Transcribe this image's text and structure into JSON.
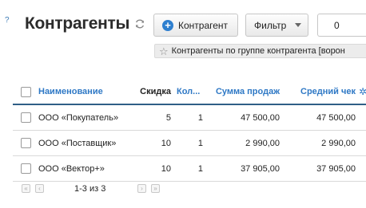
{
  "header": {
    "help_glyph": "?",
    "title": "Контрагенты",
    "add_button_label": "Контрагент",
    "filter_button_label": "Фильтр",
    "counter_value": "0"
  },
  "filter_tag": {
    "label": "Контрагенты по группе контрагента [ворон"
  },
  "table": {
    "columns": {
      "name": "Наименование",
      "discount": "Скидка",
      "count": "Кол...",
      "sales": "Сумма продаж",
      "avg_check": "Средний чек"
    },
    "rows": [
      {
        "name": "ООО «Покупатель»",
        "discount": "5",
        "count": "1",
        "sales": "47 500,00",
        "avg_check": "47 500,00"
      },
      {
        "name": "ООО «Поставщик»",
        "discount": "10",
        "count": "1",
        "sales": "2 990,00",
        "avg_check": "2 990,00"
      },
      {
        "name": "ООО «Вектор+»",
        "discount": "10",
        "count": "1",
        "sales": "37 905,00",
        "avg_check": "37 905,00"
      }
    ]
  },
  "pager": {
    "first_glyph": "«",
    "prev_glyph": "‹",
    "next_glyph": "›",
    "last_glyph": "»",
    "info": "1-3 из 3"
  },
  "colors": {
    "accent": "#2e78c5",
    "header_rule": "#2f5f86"
  }
}
